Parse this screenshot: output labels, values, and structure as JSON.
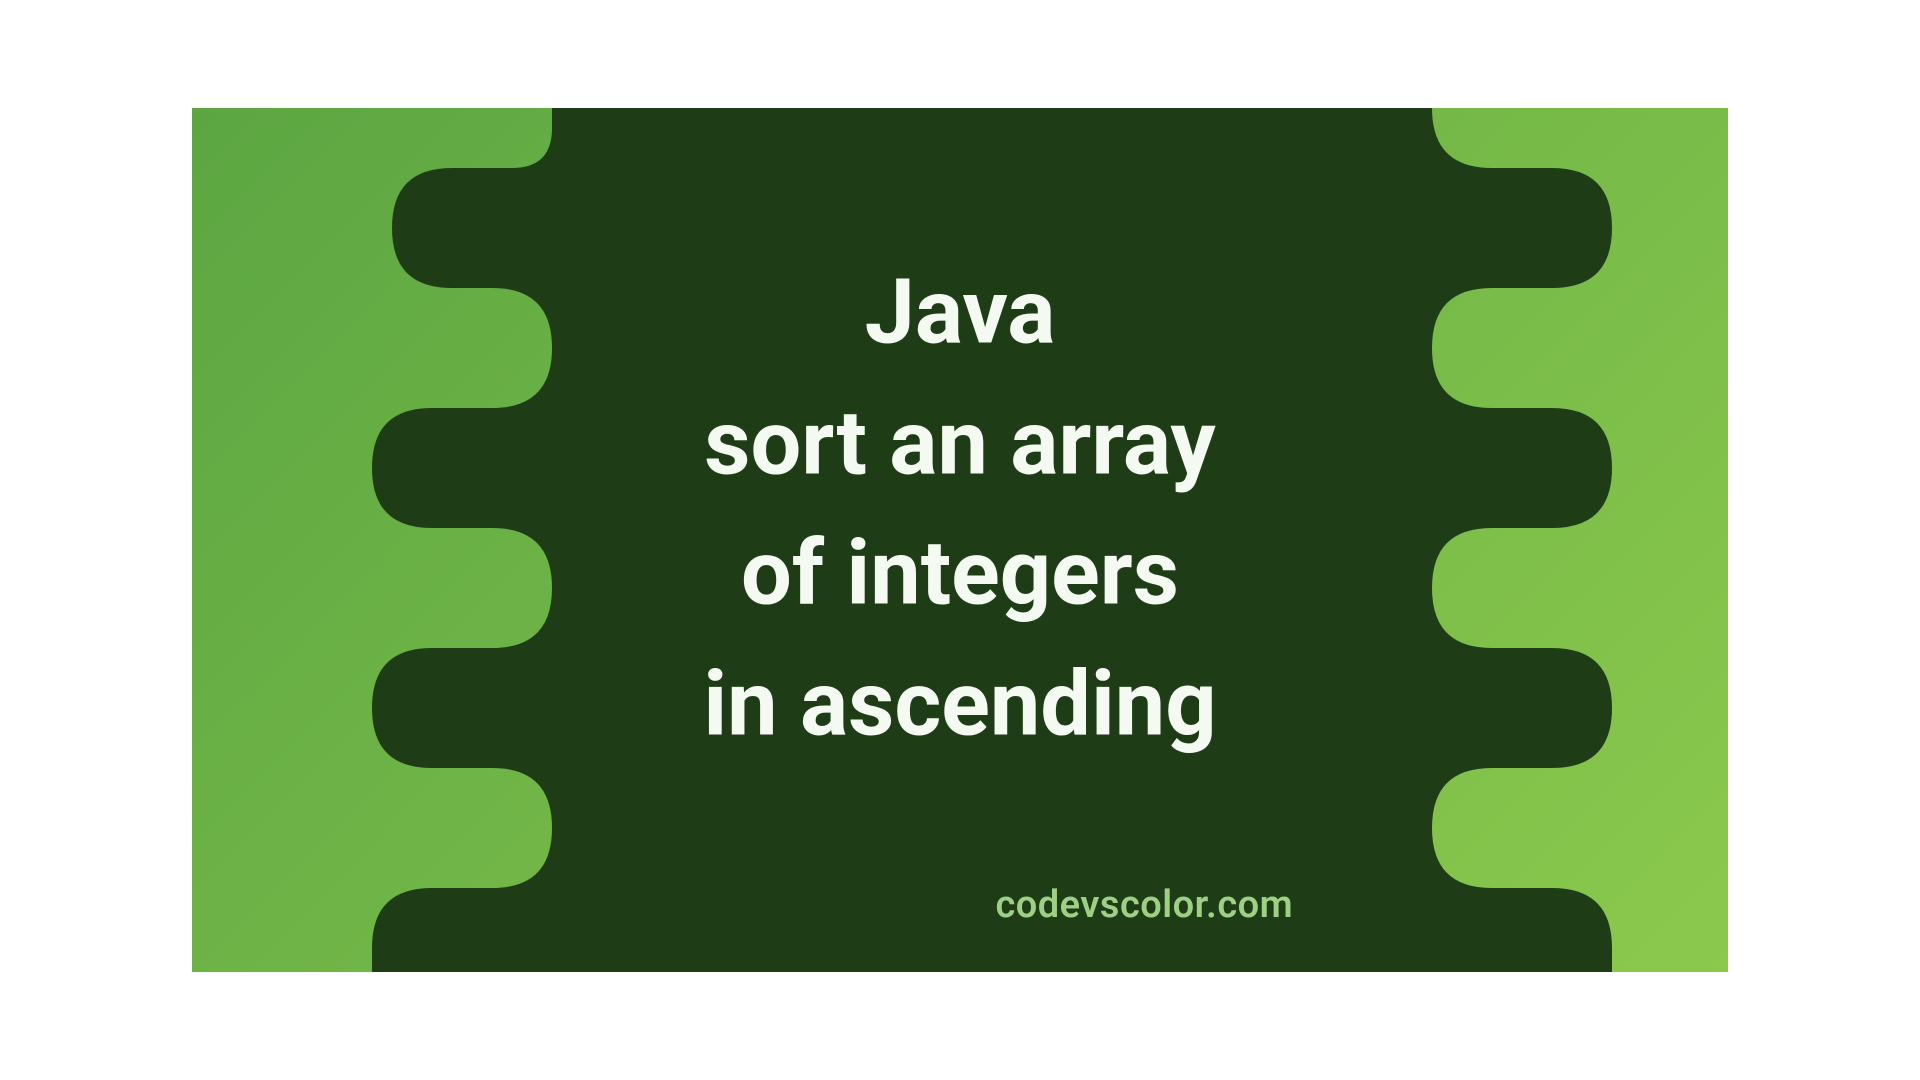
{
  "title": {
    "line1": "Java",
    "line2": "sort an array",
    "line3": "of integers",
    "line4": "in ascending"
  },
  "credit": "codevscolor.com",
  "colors": {
    "bg_gradient_start": "#5ca642",
    "bg_gradient_end": "#8bc94d",
    "blob": "#1e3d17",
    "title_text": "#f4f9f1",
    "credit_text": "#9fcf85"
  }
}
